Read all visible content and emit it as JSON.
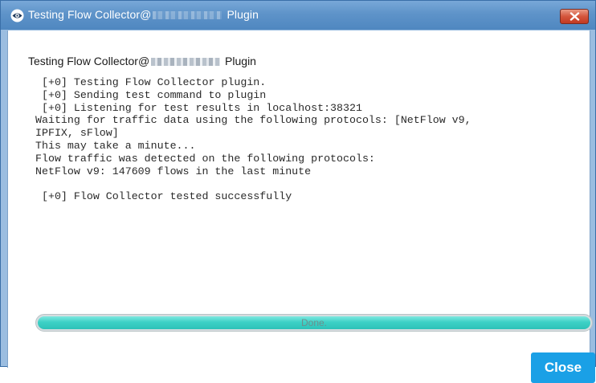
{
  "window": {
    "title_prefix": "Testing Flow Collector@",
    "title_suffix": "Plugin"
  },
  "heading": {
    "prefix": "Testing Flow Collector@",
    "suffix": "Plugin"
  },
  "log": {
    "lines": [
      " [+0] Testing Flow Collector plugin.",
      " [+0] Sending test command to plugin",
      " [+0] Listening for test results in localhost:38321",
      "Waiting for traffic data using the following protocols: [NetFlow v9,",
      "IPFIX, sFlow]",
      "This may take a minute...",
      "Flow traffic was detected on the following protocols:",
      "NetFlow v9: 147609 flows in the last minute",
      "",
      " [+0] Flow Collector tested successfully"
    ]
  },
  "progress": {
    "label": "Done.",
    "fraction": 1.0
  },
  "buttons": {
    "close_label": "Close"
  },
  "icons": {
    "app": "eye-icon",
    "titlebar_close": "close-icon"
  },
  "colors": {
    "titlebar": "#5e93c9",
    "progress_fill": "#3dd1c6",
    "close_button": "#1aa0e6",
    "window_close": "#c23a22"
  }
}
